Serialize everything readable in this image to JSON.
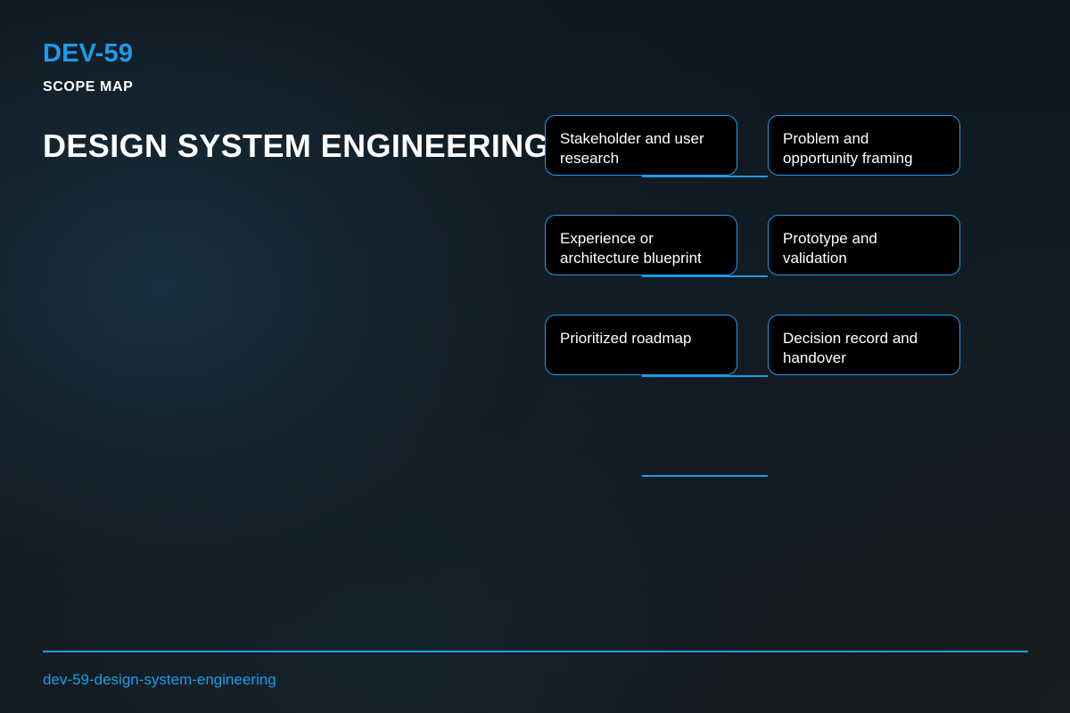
{
  "header": {
    "code": "DEV-59",
    "subtitle": "SCOPE MAP",
    "title": "DESIGN SYSTEM ENGINEERING"
  },
  "nodes": [
    "Stakeholder and user research",
    "Problem and opportunity framing",
    "Experience or architecture blueprint",
    "Prototype and validation",
    "Prioritized roadmap",
    "Decision record and handover"
  ],
  "footer": {
    "slug": "dev-59-design-system-engineering"
  },
  "colors": {
    "accent": "#1e9be9",
    "node_fill": "#000000",
    "text": "#ffffff"
  }
}
